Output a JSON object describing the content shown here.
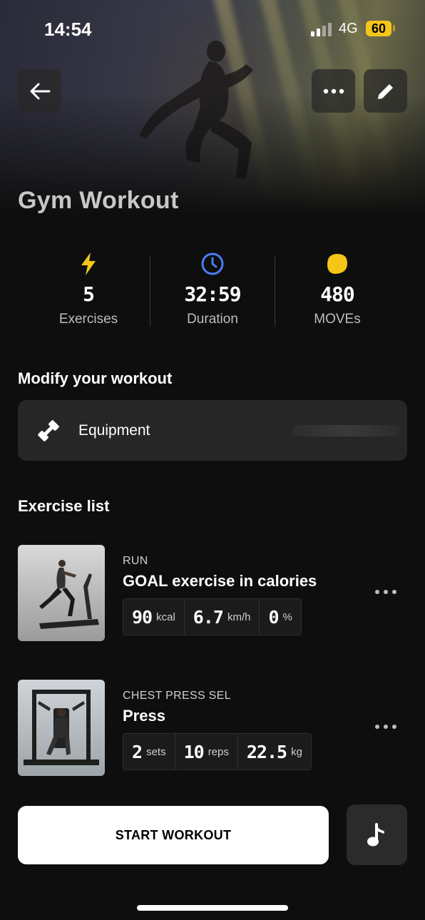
{
  "status_bar": {
    "time": "14:54",
    "network": "4G",
    "battery": "60"
  },
  "header": {
    "title": "Gym Workout"
  },
  "stats": [
    {
      "value": "5",
      "label": "Exercises",
      "icon": "lightning-icon",
      "color": "#f5c518"
    },
    {
      "value": "32:59",
      "label": "Duration",
      "icon": "clock-icon",
      "color": "#4a7cf7"
    },
    {
      "value": "480",
      "label": "MOVEs",
      "icon": "moves-icon",
      "color": "#f5c518"
    }
  ],
  "modify": {
    "heading": "Modify your workout",
    "equipment_label": "Equipment"
  },
  "exercise_list": {
    "heading": "Exercise list",
    "items": [
      {
        "category": "RUN",
        "name": "GOAL exercise in calories",
        "metrics": [
          {
            "value": "90",
            "unit": "kcal"
          },
          {
            "value": "6.7",
            "unit": "km/h"
          },
          {
            "value": "0",
            "unit": "%"
          }
        ]
      },
      {
        "category": "CHEST PRESS SEL",
        "name": "Press",
        "metrics": [
          {
            "value": "2",
            "unit": "sets"
          },
          {
            "value": "10",
            "unit": "reps"
          },
          {
            "value": "22.5",
            "unit": "kg"
          }
        ]
      }
    ]
  },
  "footer": {
    "start_label": "START WORKOUT"
  },
  "colors": {
    "accent_yellow": "#f5c518",
    "accent_blue": "#4a7cf7",
    "background": "#0e0e0e"
  }
}
